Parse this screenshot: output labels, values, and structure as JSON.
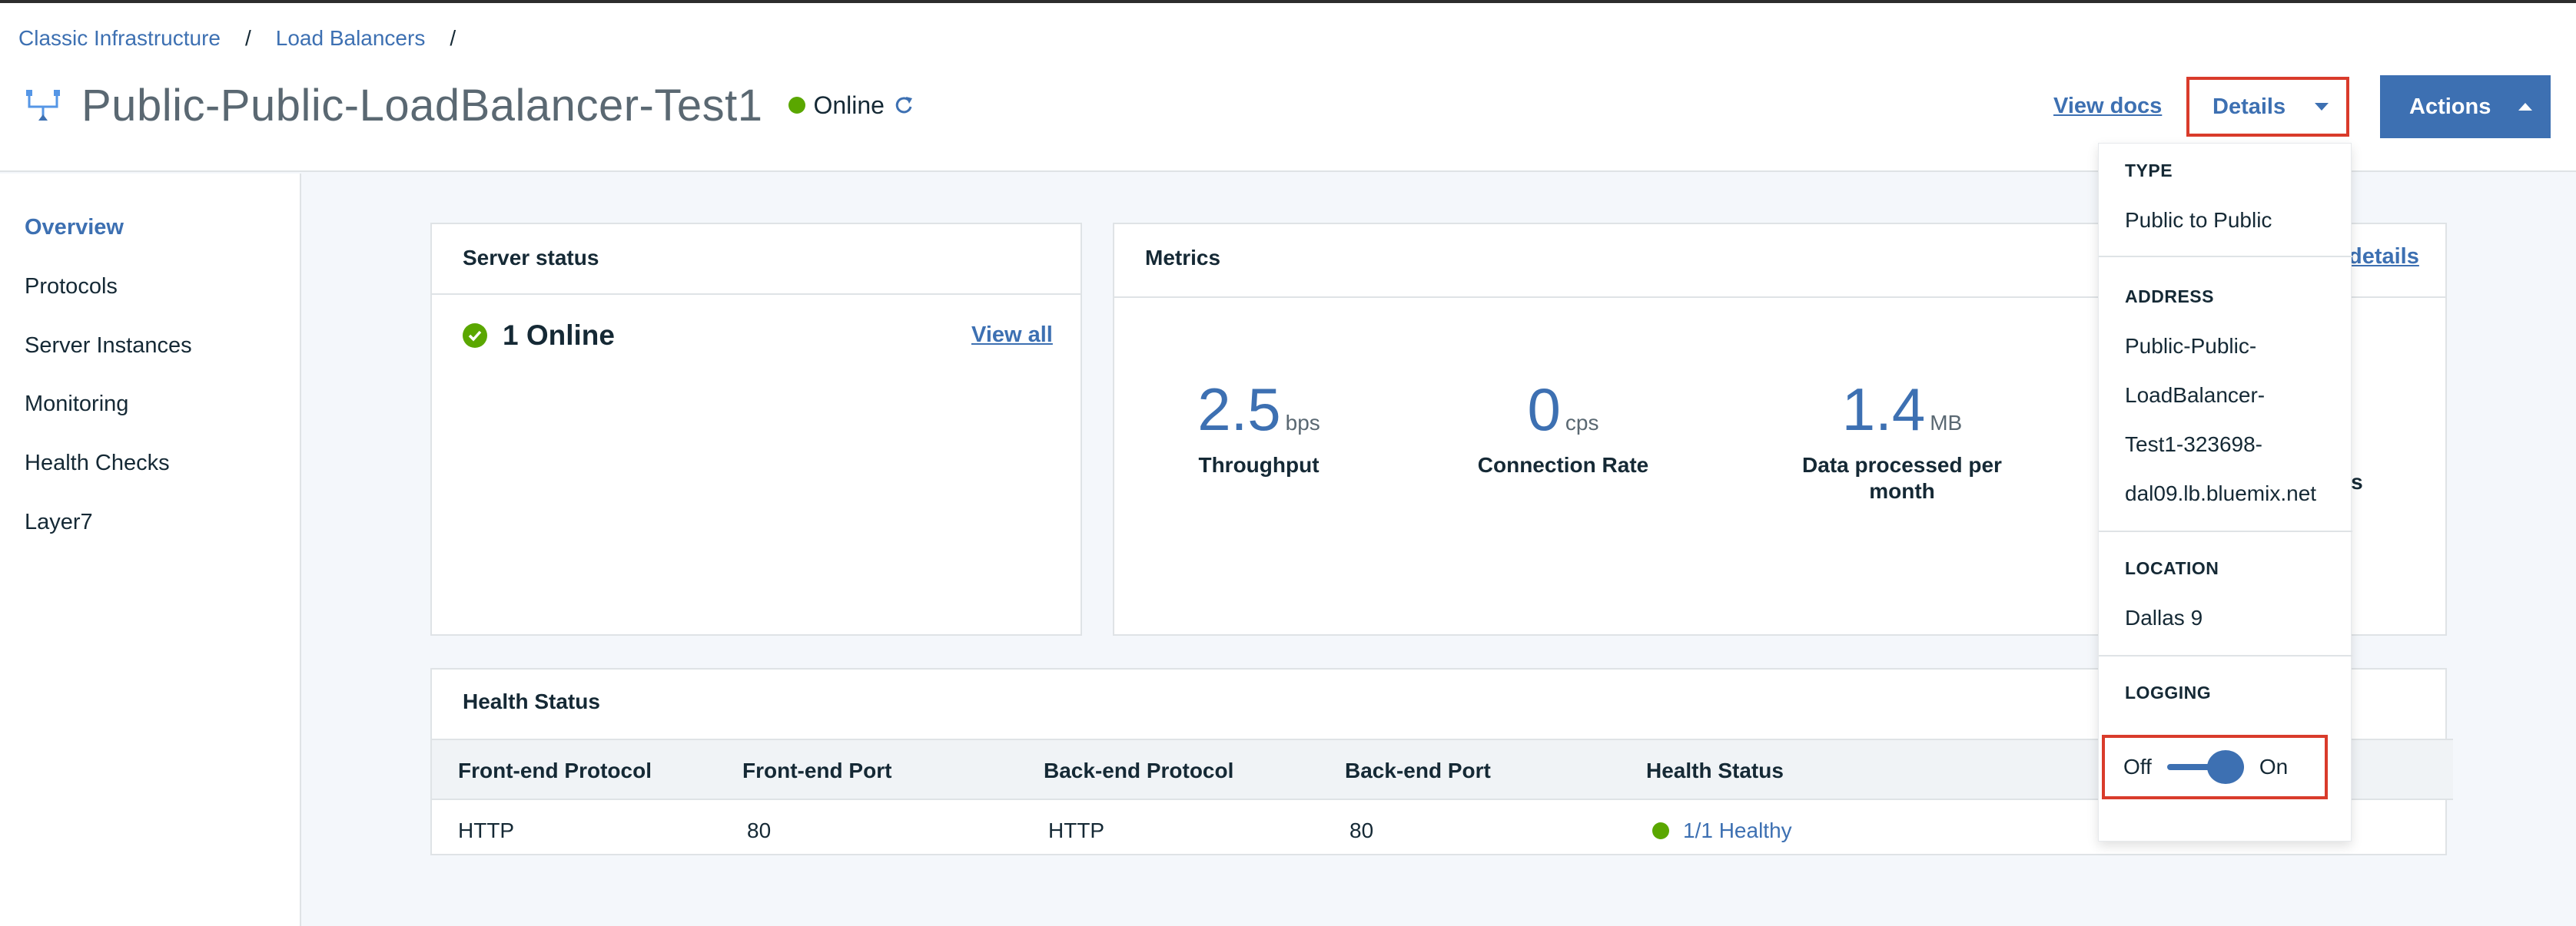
{
  "breadcrumb": {
    "items": [
      "Classic Infrastructure",
      "Load Balancers"
    ],
    "separator": "/"
  },
  "header": {
    "title": "Public-Public-LoadBalancer-Test1",
    "status": "Online",
    "view_docs": "View docs",
    "details_label": "Details",
    "actions_label": "Actions"
  },
  "sidebar": {
    "items": [
      {
        "label": "Overview",
        "active": true
      },
      {
        "label": "Protocols"
      },
      {
        "label": "Server Instances"
      },
      {
        "label": "Monitoring"
      },
      {
        "label": "Health Checks"
      },
      {
        "label": "Layer7"
      }
    ]
  },
  "server_status": {
    "title": "Server status",
    "online": "1 Online",
    "view_all": "View all"
  },
  "metrics": {
    "title": "Metrics",
    "link_partial": "details",
    "cut_label": "ns",
    "items": [
      {
        "value": "2.5",
        "unit": "bps",
        "label": "Throughput"
      },
      {
        "value": "0",
        "unit": "cps",
        "label": "Connection Rate"
      },
      {
        "value": "1.4",
        "unit": "MB",
        "label": "Data processed per month"
      }
    ]
  },
  "health_status": {
    "title": "Health Status",
    "columns": [
      "Front-end Protocol",
      "Front-end Port",
      "Back-end Protocol",
      "Back-end Port",
      "Health Status"
    ],
    "rows": [
      [
        "HTTP",
        "80",
        "HTTP",
        "80",
        "1/1 Healthy"
      ]
    ]
  },
  "details_dropdown": {
    "type_title": "TYPE",
    "type_value": "Public to Public",
    "address_title": "ADDRESS",
    "address_lines": [
      "Public-Public-",
      "LoadBalancer-",
      "Test1-323698-",
      "dal09.lb.bluemix.net"
    ],
    "location_title": "LOCATION",
    "location_value": "Dallas 9",
    "logging_title": "LOGGING",
    "logging_off": "Off",
    "logging_on": "On",
    "logging_enabled": true
  },
  "colors": {
    "accent": "#3d70b2",
    "online": "#5aa700",
    "highlight": "#d93b2b"
  }
}
